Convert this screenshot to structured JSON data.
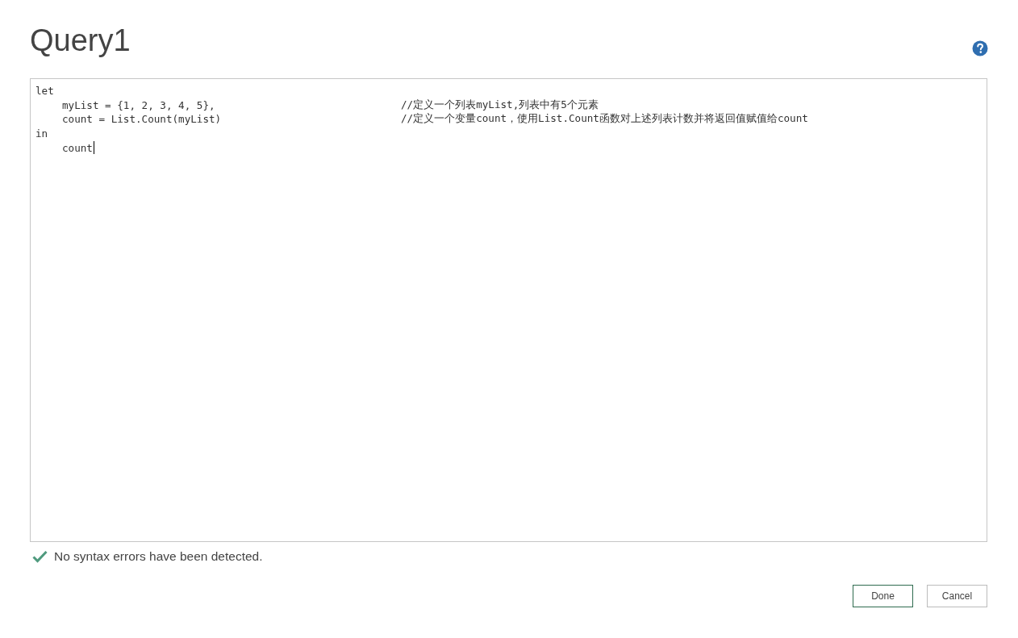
{
  "window": {
    "title": "Query1"
  },
  "editor": {
    "lines": [
      {
        "code": "let",
        "children": [
          {
            "code": "myList = {1, 2, 3, 4, 5},",
            "comment": "//定义一个列表myList,列表中有5个元素"
          },
          {
            "code": "count = List.Count(myList)",
            "comment": "//定义一个变量count，使用List.Count函数对上述列表计数并将返回值赋值给count"
          }
        ]
      },
      {
        "code": "in",
        "children": [
          {
            "code": "count",
            "cursor": true
          }
        ]
      }
    ]
  },
  "status": {
    "text": "No syntax errors have been detected.",
    "ok": true
  },
  "buttons": [
    {
      "label": "Done",
      "primary": true
    },
    {
      "label": "Cancel",
      "primary": false
    }
  ]
}
